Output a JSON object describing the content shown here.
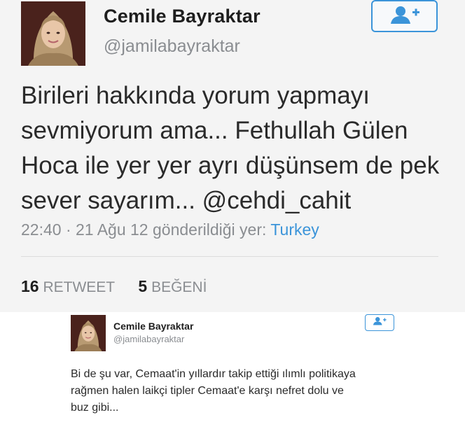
{
  "colors": {
    "accent": "#3b94d9",
    "muted": "#8a8d91",
    "text": "#2a2a2a",
    "background_top": "#f4f4f4"
  },
  "tweet_main": {
    "author_name": "Cemile Bayraktar",
    "author_handle": "@jamilabayraktar",
    "follow_icon": "follow-user-icon",
    "text": "Birileri hakkında yorum yapmayı\nsevmiyorum ama... Fethullah Gülen\nHoca ile yer yer ayrı düşünsem de pek\nsever sayarım... @cehdi_cahit",
    "timestamp": "22:40 · 21 Ağu 12",
    "sent_from_label": "gönderildiği yer:",
    "location": "Turkey",
    "retweet_count": "16",
    "retweet_label": "RETWEET",
    "like_count": "5",
    "like_label": "BEĞENİ"
  },
  "tweet_second": {
    "author_name": "Cemile Bayraktar",
    "author_handle": "@jamilabayraktar",
    "follow_icon": "follow-user-icon",
    "text": "Bi de şu var, Cemaat'in yıllardır takip ettiği ılımlı politikaya\nrağmen halen laikçi tipler Cemaat'e karşı nefret dolu ve\nbuz gibi..."
  }
}
